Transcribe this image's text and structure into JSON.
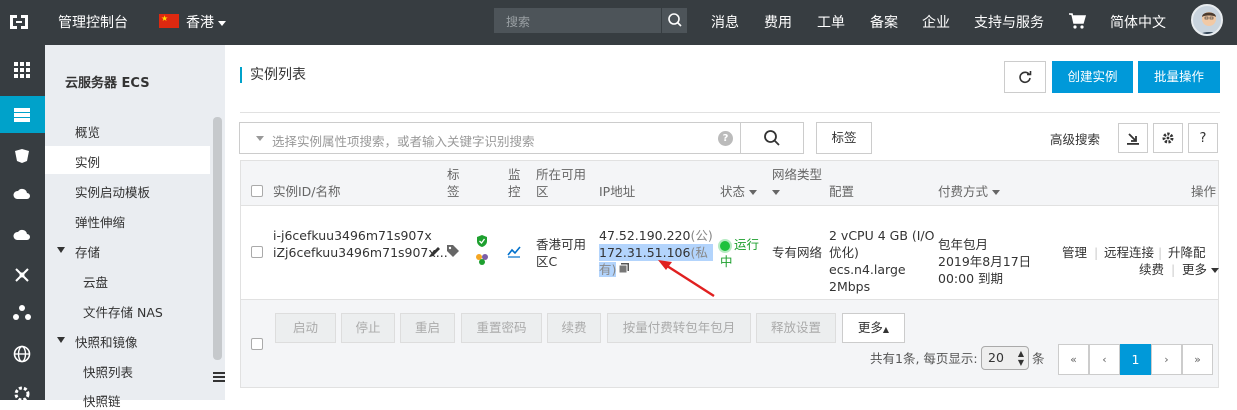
{
  "topbar": {
    "console": "管理控制台",
    "region": "香港",
    "search_placeholder": "搜索",
    "nav": [
      "消息",
      "费用",
      "工单",
      "备案",
      "企业",
      "支持与服务"
    ],
    "language": "简体中文"
  },
  "sidebar": {
    "title": "云服务器 ECS",
    "items": [
      "概览",
      "实例",
      "实例启动模板",
      "弹性伸缩"
    ],
    "storage_group": "存储",
    "storage_items": [
      "云盘",
      "文件存储 NAS"
    ],
    "snapshot_group": "快照和镜像",
    "snapshot_items": [
      "快照列表",
      "快照链"
    ]
  },
  "page": {
    "title": "实例列表",
    "create_button": "创建实例",
    "batch_button": "批量操作",
    "filter_placeholder": "选择实例属性项搜索，或者输入关键字识别搜索",
    "tag_button": "标签",
    "advanced_search": "高级搜索"
  },
  "table": {
    "headers": {
      "id_name": "实例ID/名称",
      "tag_1": "标",
      "tag_2": "签",
      "monitor_1": "监",
      "monitor_2": "控",
      "zone_1": "所在可用",
      "zone_2": "区",
      "ip": "IP地址",
      "status": "状态",
      "network_1": "网络类型",
      "config": "配置",
      "billing": "付费方式",
      "actions": "操作"
    },
    "row": {
      "id": "i-j6cefkuu3496m71s907x",
      "name": "iZj6cefkuu3496m71s907x...",
      "zone_1": "香港可用",
      "zone_2": "区C",
      "public_ip": "47.52.190.220",
      "public_suffix": "(公)",
      "private_ip": "172.31.51.106",
      "private_suffix_1": "(私",
      "private_suffix_2": "有)",
      "status_1": "运行",
      "status_2": "中",
      "network": "专有网络",
      "config_1": "2 vCPU 4 GB (I/O",
      "config_2": "优化)",
      "config_3": "ecs.n4.large",
      "config_4": "2Mbps",
      "billing_1": "包年包月",
      "billing_2": "2019年8月17日",
      "billing_3": "00:00 到期",
      "action_manage": "管理",
      "action_remote": "远程连接",
      "action_upgrade": "升降配",
      "action_renew": "续费",
      "action_more": "更多"
    }
  },
  "footer": {
    "buttons": [
      "启动",
      "停止",
      "重启",
      "重置密码",
      "续费",
      "按量付费转包年包月",
      "释放设置"
    ],
    "more": "更多",
    "summary": "共有1条, 每页显示:",
    "page_size": "20",
    "unit": "条",
    "pages": [
      "«",
      "‹",
      "1",
      "›",
      "»"
    ]
  },
  "colors": {
    "topbar": "#373d41",
    "accent": "#0099d9",
    "sidebar": "#eaedf1",
    "link": "#0070cc",
    "running": "#1ec13d"
  }
}
